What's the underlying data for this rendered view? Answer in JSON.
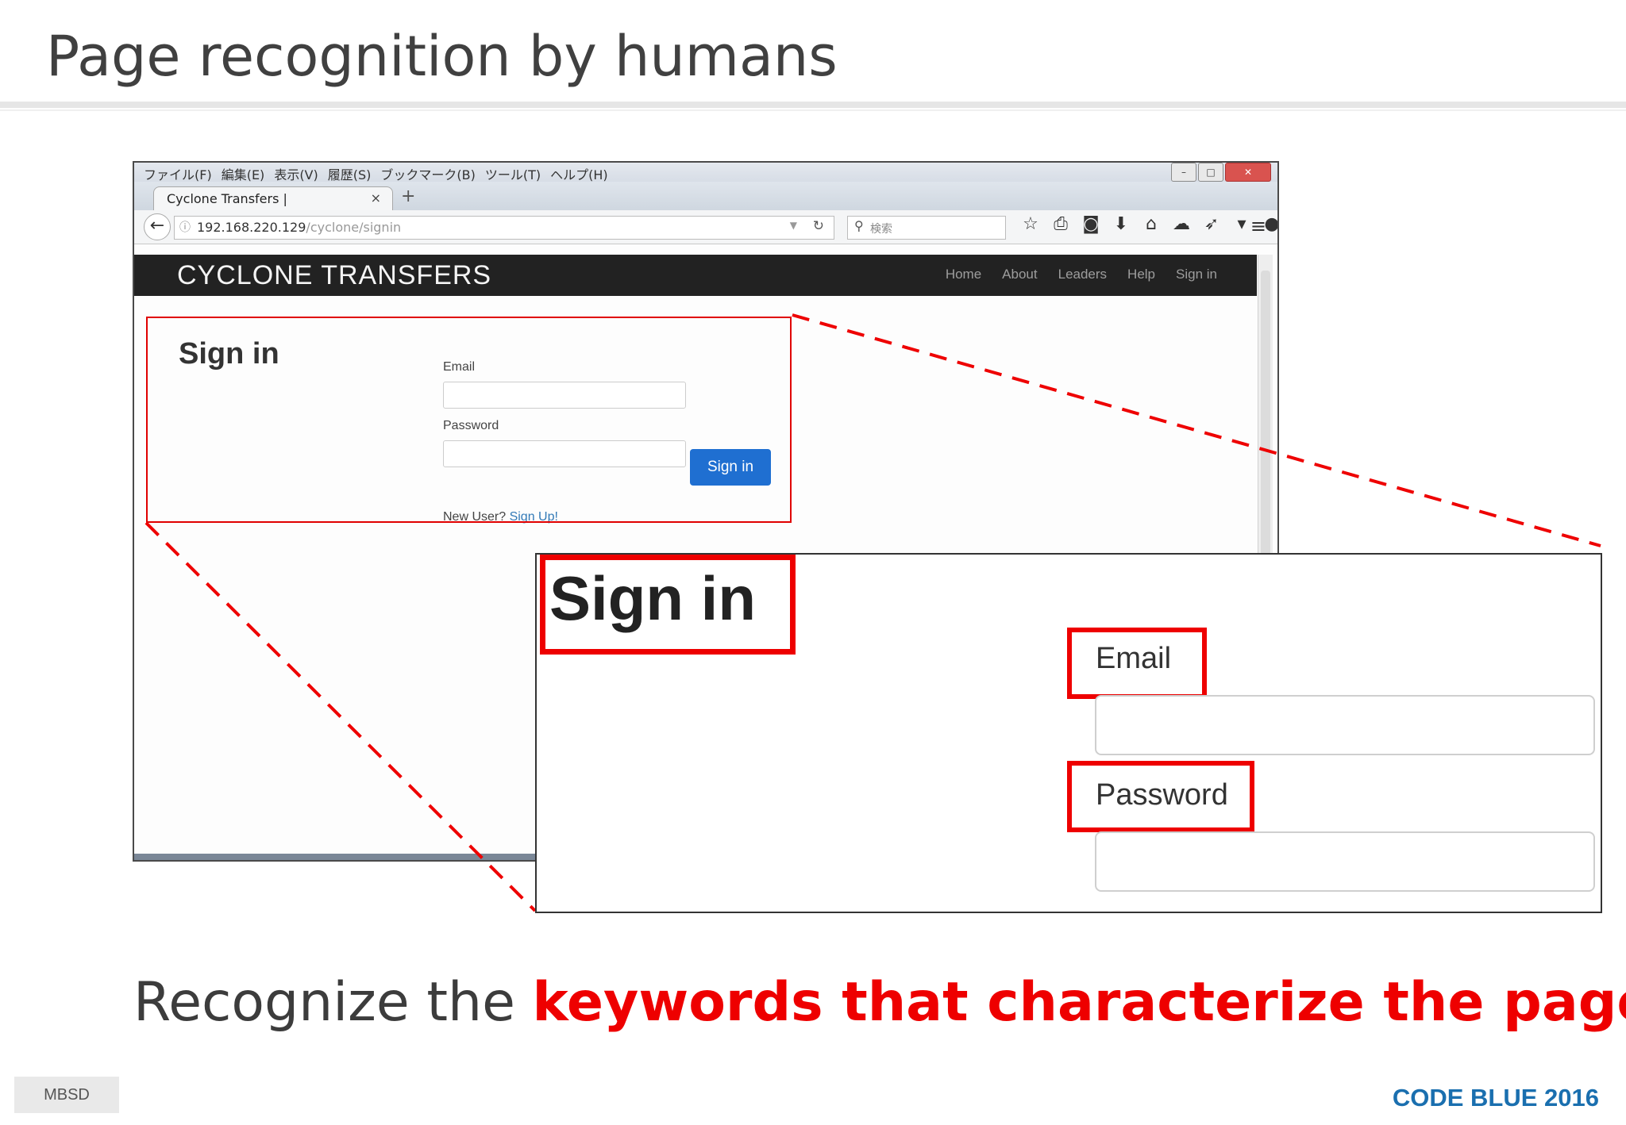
{
  "slide": {
    "title": "Page recognition by humans",
    "caption_plain": "Recognize the ",
    "caption_emphasis": "keywords that characterize the page",
    "caption_end": ".",
    "footer_left": "MBSD",
    "footer_right": "CODE BLUE 2016"
  },
  "browser": {
    "menu_items": [
      "ファイル(F)",
      "編集(E)",
      "表示(V)",
      "履歴(S)",
      "ブックマーク(B)",
      "ツール(T)",
      "ヘルプ(H)"
    ],
    "tab_title": "Cyclone Transfers |",
    "tab_close": "×",
    "new_tab": "+",
    "url_host": "192.168.220.129",
    "url_path": "/cyclone/signin",
    "search_placeholder": "検索",
    "toolbar_icons": [
      "star-icon",
      "clipboard-icon",
      "pocket-icon",
      "download-icon",
      "home-icon",
      "chat-icon",
      "send-icon",
      "dropdown-icon",
      "avatar-icon"
    ],
    "toolbar_glyphs": [
      "☆",
      "⎙",
      "◙",
      "⬇",
      "⌂",
      "☁",
      "➶",
      "▾",
      "●"
    ]
  },
  "site": {
    "brand": "CYCLONE TRANSFERS",
    "nav": [
      "Home",
      "About",
      "Leaders",
      "Help",
      "Sign in"
    ],
    "heading": "Sign in",
    "email_label": "Email",
    "password_label": "Password",
    "submit_label": "Sign in",
    "new_user_text": "New User? ",
    "signup_link": "Sign Up!"
  },
  "zoom": {
    "heading": "Sign in",
    "email_label": "Email",
    "password_label": "Password"
  },
  "colors": {
    "highlight": "#ee0000",
    "brand_blue": "#1a6faf",
    "site_bar": "#222222",
    "button_blue": "#1f6fd1"
  }
}
